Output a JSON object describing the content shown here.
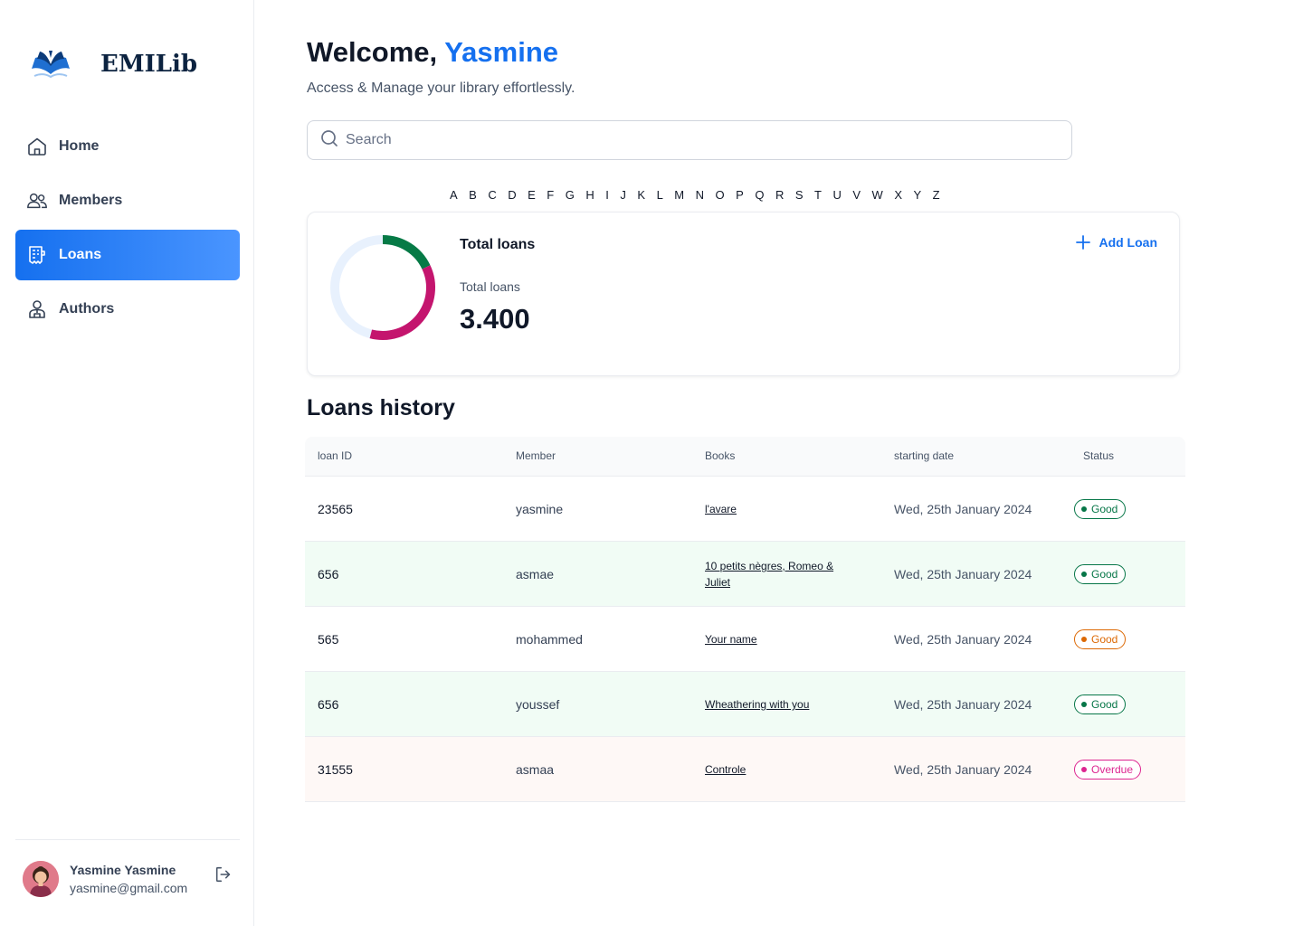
{
  "brand": {
    "name": "EMILib",
    "logo_icon": "open-book-icon"
  },
  "nav": [
    {
      "label": "Home",
      "icon": "home-icon",
      "active": false
    },
    {
      "label": "Members",
      "icon": "users-icon",
      "active": false
    },
    {
      "label": "Loans",
      "icon": "receipt-icon",
      "active": true
    },
    {
      "label": "Authors",
      "icon": "author-icon",
      "active": false
    }
  ],
  "user": {
    "name": "Yasmine Yasmine",
    "email": "yasmine@gmail.com",
    "logout_icon": "logout-icon"
  },
  "header": {
    "welcome": "Welcome,",
    "name": "Yasmine",
    "subtitle": "Access & Manage your library effortlessly."
  },
  "search": {
    "placeholder": "Search",
    "value": ""
  },
  "alphabet": [
    "A",
    "B",
    "C",
    "D",
    "E",
    "F",
    "G",
    "H",
    "I",
    "J",
    "K",
    "L",
    "M",
    "N",
    "O",
    "P",
    "Q",
    "R",
    "S",
    "T",
    "U",
    "V",
    "W",
    "X",
    "Y",
    "Z"
  ],
  "summary": {
    "title": "Total loans",
    "label": "Total loans",
    "value": "3.400",
    "add_label": "Add Loan",
    "donut": {
      "segments": [
        {
          "fraction": 0.18,
          "color": "#067a46"
        },
        {
          "fraction": 0.36,
          "color": "#c4156e"
        }
      ],
      "track_color": "#e8f1fd"
    }
  },
  "history": {
    "title": "Loans history",
    "columns": [
      "loan ID",
      "Member",
      "Books",
      "starting date",
      "Status"
    ],
    "rows": [
      {
        "id": "23565",
        "member": "yasmine",
        "books": "l'avare",
        "date": "Wed, 25th January 2024",
        "status": "Good",
        "tone": "good",
        "bg": "white"
      },
      {
        "id": "656",
        "member": "asmae",
        "books": "10 petits nègres, Romeo & Juliet",
        "date": "Wed, 25th January 2024",
        "status": "Good",
        "tone": "good",
        "bg": "green"
      },
      {
        "id": "565",
        "member": "mohammed",
        "books": "Your name",
        "date": "Wed, 25th January 2024",
        "status": "Good",
        "tone": "warn",
        "bg": "white"
      },
      {
        "id": "656",
        "member": "youssef",
        "books": "Wheathering with you",
        "date": "Wed, 25th January 2024",
        "status": "Good",
        "tone": "good",
        "bg": "green"
      },
      {
        "id": "31555",
        "member": "asmaa",
        "books": "Controle",
        "date": "Wed, 25th January 2024",
        "status": "Overdue",
        "tone": "overdue",
        "bg": "red"
      }
    ]
  }
}
